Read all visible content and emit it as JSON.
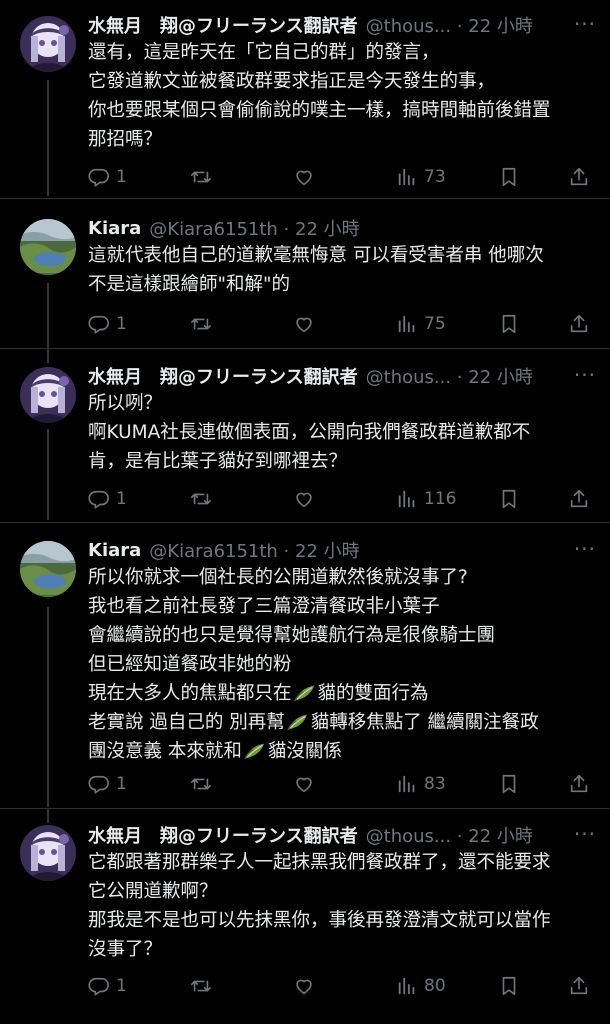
{
  "tweets": [
    {
      "name": "水無月　翔@フリーランス翻訳者",
      "handle_time": "@thous... · 22 小時",
      "lines": [
        "還有，這是昨天在「它自己的群」的發言，",
        "它發道歉文並被餐政群要求指正是今天發生的事，",
        "你也要跟某個只會偷偷說的噗主一樣，搞時間軸前後錯置",
        "那招嗎？"
      ],
      "replies": "1",
      "views": "73"
    },
    {
      "name": "Kiara",
      "handle_time": "@Kiara6151th · 22 小時",
      "lines": [
        "這就代表他自己的道歉毫無悔意 可以看受害者串 他哪次",
        "不是這樣跟繪師\"和解\"的"
      ],
      "replies": "1",
      "views": "75"
    },
    {
      "name": "水無月　翔@フリーランス翻訳者",
      "handle_time": "@thous... · 22 小時",
      "lines": [
        "所以咧？",
        "啊KUMA社長連做個表面，公開向我們餐政群道歉都不",
        "肯，是有比葉子貓好到哪裡去？"
      ],
      "replies": "1",
      "views": "116"
    },
    {
      "name": "Kiara",
      "handle_time": "@Kiara6151th · 22 小時",
      "lines": [
        "所以你就求一個社長的公開道歉然後就沒事了?",
        "我也看之前社長發了三篇澄清餐政非小葉子",
        "會繼續說的也只是覺得幫她護航行為是很像騎士團",
        "但已經知道餐政非她的粉"
      ],
      "line5": [
        "現在大多人的焦點都只在",
        "貓的雙面行為"
      ],
      "line6": [
        "老實說 過自己的 別再幫",
        "貓轉移焦點了 繼續關注餐政"
      ],
      "line7": [
        "團沒意義 本來就和",
        "貓沒關係"
      ],
      "replies": "1",
      "views": "83"
    },
    {
      "name": "水無月　翔@フリーランス翻訳者",
      "handle_time": "@thous... · 22 小時",
      "lines": [
        "它都跟著那群樂子人一起抹黑我們餐政群了，還不能要求",
        "它公開道歉啊？",
        "那我是不是也可以先抹黑你，事後再發澄清文就可以當作",
        "沒事了？"
      ],
      "replies": "1",
      "views": "80"
    }
  ],
  "more_label": "···",
  "colors": {
    "text": "#e7e9ea",
    "secondary": "#71767b",
    "background": "#000000"
  }
}
